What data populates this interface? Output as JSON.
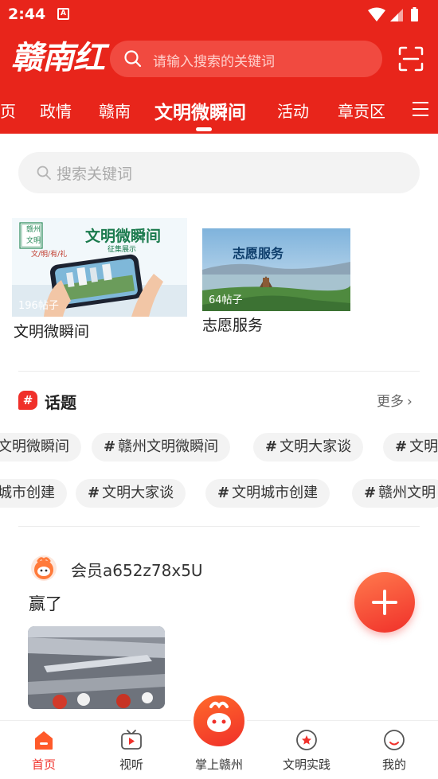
{
  "status": {
    "time": "2:44",
    "notif_badge": "A"
  },
  "header": {
    "logo": "赣南红",
    "search_placeholder": "请输入搜索的关键词"
  },
  "tabs": [
    {
      "label": "页"
    },
    {
      "label": "政情"
    },
    {
      "label": "赣南"
    },
    {
      "label": "文明微瞬间",
      "active": true
    },
    {
      "label": "活动"
    },
    {
      "label": "章贡区"
    }
  ],
  "search": {
    "placeholder": "搜索关键词"
  },
  "cards": [
    {
      "title": "文明微瞬间",
      "count": "196帖子",
      "image_title": "文明微瞬间",
      "image_subtitle": "征集展示",
      "image_tag": "文/明/有/礼",
      "image_seal": "赣州文明"
    },
    {
      "title": "志愿服务",
      "count": "64帖子",
      "image_title": "志愿服务"
    }
  ],
  "topics": {
    "title": "话题",
    "more": "更多",
    "row1": [
      "文明微瞬间",
      "赣州文明微瞬间",
      "文明大家谈",
      "文明"
    ],
    "row2": [
      "城市创建",
      "文明大家谈",
      "文明城市创建",
      "赣州文明"
    ]
  },
  "post": {
    "username": "会员a652z78x5U",
    "text": "赢了"
  },
  "bottom_nav": [
    {
      "label": "首页",
      "active": true
    },
    {
      "label": "视听"
    },
    {
      "label": "掌上赣州"
    },
    {
      "label": "文明实践"
    },
    {
      "label": "我的"
    }
  ],
  "colors": {
    "brand": "#e8251b",
    "accent": "#f0302a"
  }
}
